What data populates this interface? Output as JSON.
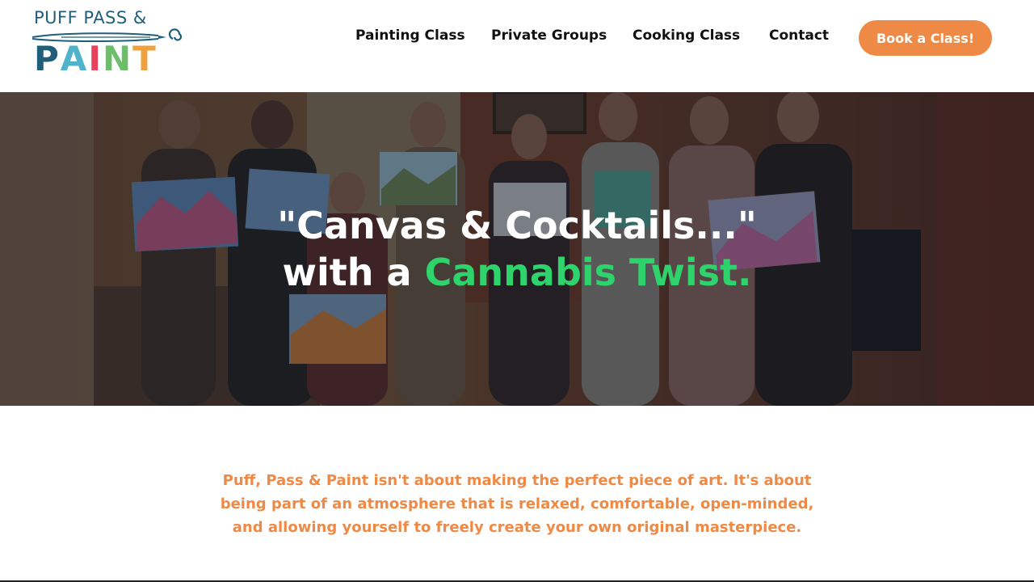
{
  "logo": {
    "line1": "PUFF PASS &",
    "line2_letters": [
      "P",
      "A",
      "I",
      "N",
      "T"
    ],
    "line2_colors": [
      "#1f5f7a",
      "#4fb3c9",
      "#e8425c",
      "#6cbf6a",
      "#f0a03c"
    ]
  },
  "nav": {
    "items": [
      "Painting Class",
      "Private Groups",
      "Cooking Class",
      "Contact"
    ],
    "cta": "Book a Class!"
  },
  "hero": {
    "line1": "\"Canvas & Cocktails...\"",
    "line2_prefix": "with a",
    "line2_accent": "Cannabis Twist."
  },
  "intro": {
    "text": "Puff, Pass & Paint isn't about making the perfect piece of art. It's about being part of an atmosphere that is relaxed, comfortable, open-minded, and allowing yourself to freely create your own original masterpiece."
  },
  "colors": {
    "accent_orange": "#ee8a45",
    "accent_green": "#2fd36b",
    "brand_teal": "#1f5f7a"
  },
  "icons": {
    "logo_brush": "paintbrush-icon"
  }
}
